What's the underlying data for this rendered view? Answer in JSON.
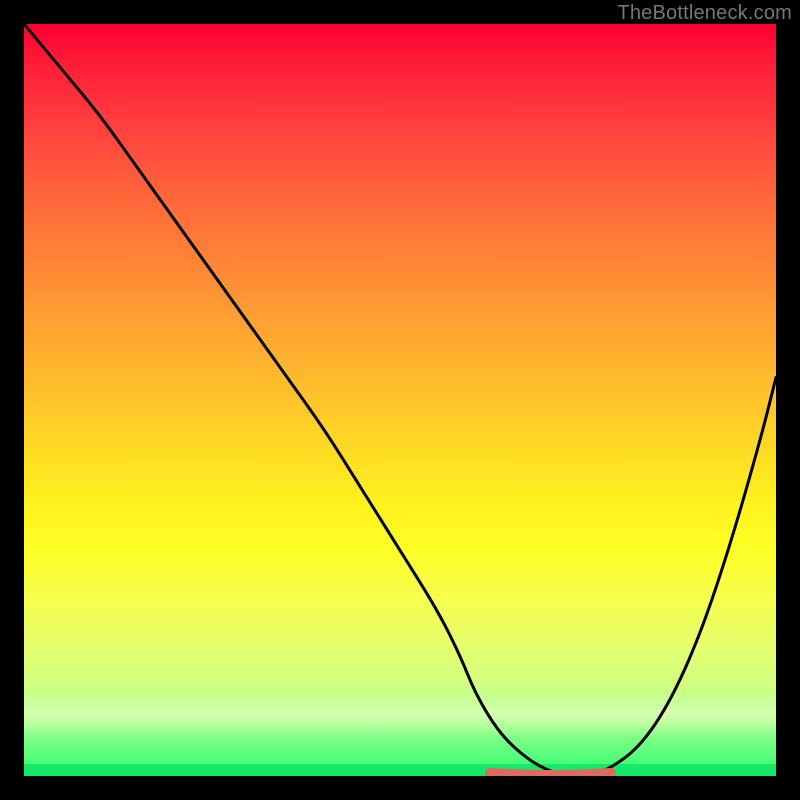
{
  "watermark": "TheBottleneck.com",
  "colors": {
    "frame": "#000000",
    "gradient_top": "#ff0030",
    "gradient_bottom": "#16e86a",
    "curve": "#000000",
    "marker": "#e06a60"
  },
  "chart_data": {
    "type": "line",
    "title": "",
    "xlabel": "",
    "ylabel": "",
    "xlim": [
      0,
      100
    ],
    "ylim": [
      0,
      100
    ],
    "series": [
      {
        "name": "bottleneck-curve",
        "x": [
          0,
          5,
          10,
          15,
          20,
          25,
          30,
          35,
          40,
          45,
          50,
          55,
          58,
          60,
          63,
          66,
          69,
          72,
          75,
          78,
          82,
          86,
          90,
          94,
          98,
          100
        ],
        "values": [
          100,
          94,
          88,
          81,
          74,
          67,
          60,
          53,
          46,
          38,
          30,
          22,
          16,
          11,
          6,
          3,
          1,
          0,
          0,
          1,
          4,
          10,
          19,
          31,
          45,
          53
        ]
      }
    ],
    "marker": {
      "name": "optimal-range",
      "x_start": 62,
      "x_end": 78,
      "y": 0.6
    },
    "annotations": []
  }
}
